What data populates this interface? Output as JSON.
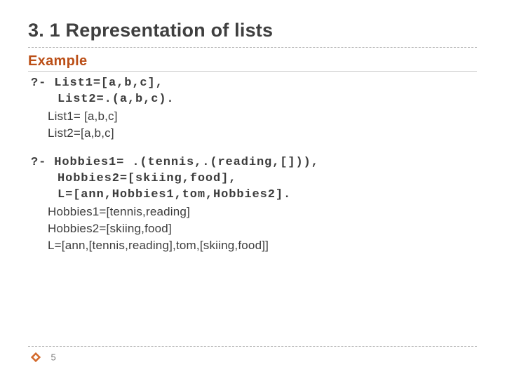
{
  "title": "3. 1 Representation of lists",
  "subheading": "Example",
  "block1": {
    "code": [
      "?- List1=[a,b,c],",
      "List2=.(a,b,c)."
    ],
    "results": [
      "List1= [a,b,c]",
      "List2=[a,b,c]"
    ]
  },
  "block2": {
    "code": [
      "?- Hobbies1= .(tennis,.(reading,[])),",
      "Hobbies2=[skiing,food],",
      "L=[ann,Hobbies1,tom,Hobbies2]."
    ],
    "results": [
      "Hobbies1=[tennis,reading]",
      "Hobbies2=[skiing,food]",
      "L=[ann,[tennis,reading],tom,[skiing,food]]"
    ]
  },
  "page_number": "5"
}
